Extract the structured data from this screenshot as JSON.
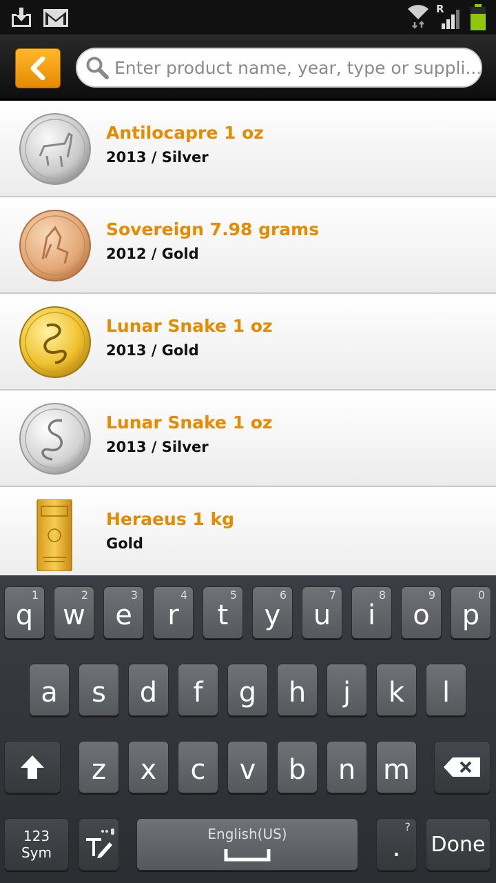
{
  "status_bar": {
    "icons": [
      "download-icon",
      "gmail-icon",
      "wifi-icon",
      "signal-icon",
      "battery-icon"
    ],
    "roaming_label": "R"
  },
  "top_bar": {
    "back_icon": "chevron-left-icon",
    "search_placeholder": "Enter product name, year, type or suppli..."
  },
  "products": [
    {
      "title": "Antilocapre 1 oz",
      "subtitle": "2013 / Silver",
      "metal": "silver",
      "shape": "coin"
    },
    {
      "title": "Sovereign 7.98 grams",
      "subtitle": "2012 / Gold",
      "metal": "rose-gold",
      "shape": "coin"
    },
    {
      "title": "Lunar Snake 1 oz",
      "subtitle": "2013 / Gold",
      "metal": "gold",
      "shape": "coin"
    },
    {
      "title": "Lunar Snake 1 oz",
      "subtitle": "2013 / Silver",
      "metal": "silver",
      "shape": "coin"
    },
    {
      "title": "Heraeus 1 kg",
      "subtitle": "Gold",
      "metal": "gold",
      "shape": "bar"
    }
  ],
  "keyboard": {
    "row1": [
      {
        "ch": "q",
        "num": "1"
      },
      {
        "ch": "w",
        "num": "2"
      },
      {
        "ch": "e",
        "num": "3"
      },
      {
        "ch": "r",
        "num": "4"
      },
      {
        "ch": "t",
        "num": "5"
      },
      {
        "ch": "y",
        "num": "6"
      },
      {
        "ch": "u",
        "num": "7"
      },
      {
        "ch": "i",
        "num": "8"
      },
      {
        "ch": "o",
        "num": "9"
      },
      {
        "ch": "p",
        "num": "0"
      }
    ],
    "row2": [
      "a",
      "s",
      "d",
      "f",
      "g",
      "h",
      "j",
      "k",
      "l"
    ],
    "row3": [
      "z",
      "x",
      "c",
      "v",
      "b",
      "n",
      "m"
    ],
    "sym_label_1": "123",
    "sym_label_2": "Sym",
    "language": "English(US)",
    "period": ".",
    "period_hint": "?",
    "done": "Done"
  },
  "colors": {
    "accent": "#e68a00",
    "title_text": "#e68a00",
    "subtitle_text": "#111111"
  }
}
